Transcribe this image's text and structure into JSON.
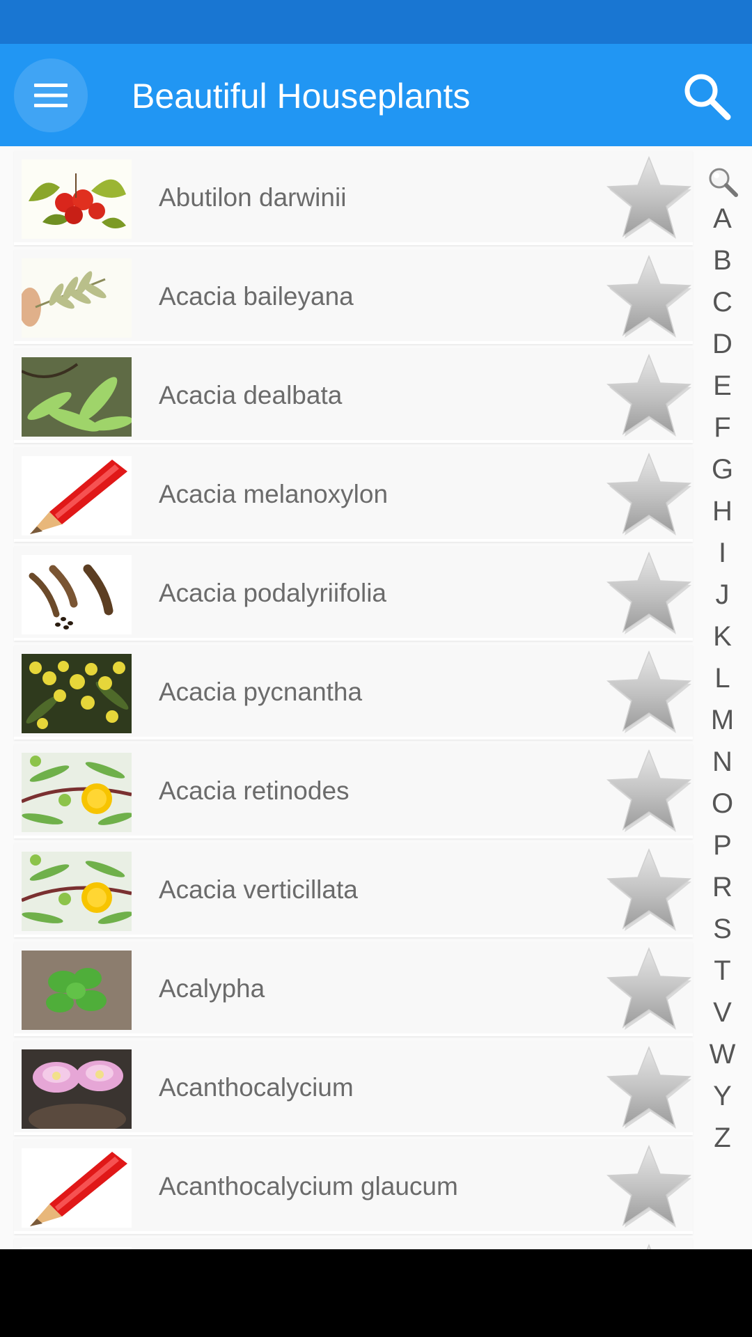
{
  "app": {
    "title": "Beautiful Houseplants"
  },
  "colors": {
    "status_bar": "#1976D2",
    "app_bar": "#2196F3",
    "row_bg": "#f8f8f8",
    "text": "#6b6b6b"
  },
  "toolbar": {
    "menu_icon": "hamburger-menu-icon",
    "search_icon": "search-icon"
  },
  "plants": [
    {
      "name": "Abutilon darwinii",
      "thumb": "abutilon"
    },
    {
      "name": "Acacia baileyana",
      "thumb": "fern-hand"
    },
    {
      "name": "Acacia dealbata",
      "thumb": "fern-green"
    },
    {
      "name": "Acacia melanoxylon",
      "thumb": "pencil"
    },
    {
      "name": "Acacia podalyriifolia",
      "thumb": "pods"
    },
    {
      "name": "Acacia pycnantha",
      "thumb": "yellow-blossom"
    },
    {
      "name": "Acacia retinodes",
      "thumb": "yellow-ball"
    },
    {
      "name": "Acacia verticillata",
      "thumb": "yellow-ball"
    },
    {
      "name": "Acalypha",
      "thumb": "seedling"
    },
    {
      "name": "Acanthocalycium",
      "thumb": "cactus-flower"
    },
    {
      "name": "Acanthocalycium glaucum",
      "thumb": "pencil"
    },
    {
      "name": "",
      "thumb": "pencil"
    }
  ],
  "favorite_icon": "star-icon",
  "index": {
    "search_icon": "magnifier-icon",
    "letters": [
      "A",
      "B",
      "C",
      "D",
      "E",
      "F",
      "G",
      "H",
      "I",
      "J",
      "K",
      "L",
      "M",
      "N",
      "O",
      "P",
      "R",
      "S",
      "T",
      "V",
      "W",
      "Y",
      "Z"
    ]
  }
}
